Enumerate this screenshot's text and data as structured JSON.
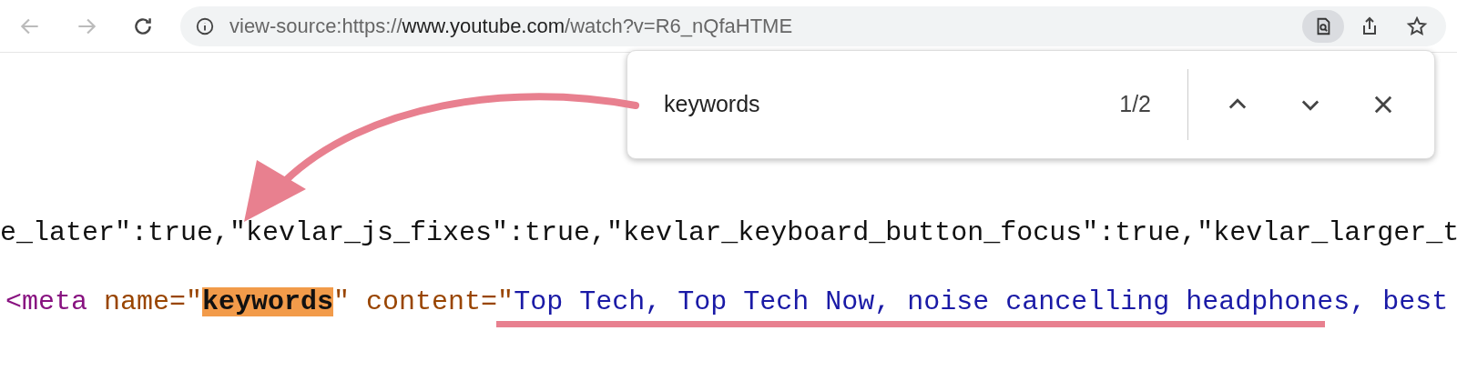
{
  "address_bar": {
    "url_scheme": "view-source:https://",
    "url_host": "www.youtube.com",
    "url_path": "/watch?v=R6_nQfaHTME",
    "find_active": true
  },
  "find_bar": {
    "query": "keywords",
    "count": "1/2"
  },
  "source_lines": [
    {
      "segments": [
        {
          "kind": "text",
          "text": "e_later\":true,\"kevlar_js_fixes\":true,\"kevlar_keyboard_button_focus\":true,\"kevlar_larger_t"
        }
      ]
    },
    {
      "segments": [
        {
          "kind": "tag",
          "text": "<meta"
        },
        {
          "kind": "attr",
          "text": " name=\""
        },
        {
          "kind": "match",
          "text": "keywords"
        },
        {
          "kind": "attr",
          "text": "\" content=\""
        },
        {
          "kind": "value",
          "text": "Top Tech, Top Tech Now, noise cancelling headphones, best"
        }
      ]
    }
  ]
}
